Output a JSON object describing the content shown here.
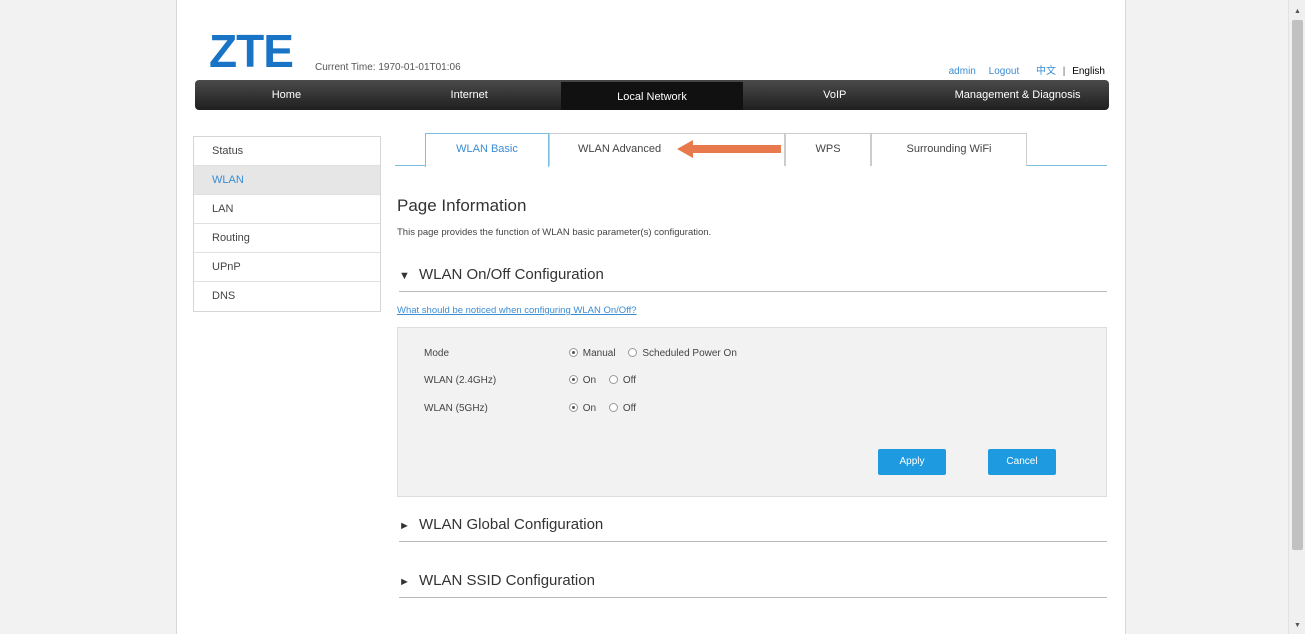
{
  "header": {
    "logo": "ZTE",
    "current_time": "Current Time: 1970-01-01T01:06",
    "user": "admin",
    "logout": "Logout",
    "lang_cn": "中文",
    "lang_sep": "|",
    "lang_en": "English"
  },
  "nav": {
    "items": [
      "Home",
      "Internet",
      "Local Network",
      "VoIP",
      "Management & Diagnosis"
    ],
    "active": "Local Network"
  },
  "sidebar": {
    "items": [
      "Status",
      "WLAN",
      "LAN",
      "Routing",
      "UPnP",
      "DNS"
    ],
    "active": "WLAN"
  },
  "tabs": {
    "items": [
      "WLAN Basic",
      "WLAN Advanced",
      "WPS",
      "Surrounding WiFi"
    ],
    "active": "WLAN Basic"
  },
  "page": {
    "title": "Page Information",
    "description": "This page provides the function of WLAN basic parameter(s) configuration."
  },
  "sections": {
    "onoff": "WLAN On/Off Configuration",
    "global": "WLAN Global Configuration",
    "ssid": "WLAN SSID Configuration"
  },
  "help_link": "What should be noticed when configuring WLAN On/Off?",
  "form": {
    "mode_label": "Mode",
    "mode_opt1": "Manual",
    "mode_opt2": "Scheduled Power On",
    "wlan24_label": "WLAN (2.4GHz)",
    "wlan5_label": "WLAN (5GHz)",
    "on": "On",
    "off": "Off",
    "apply": "Apply",
    "cancel": "Cancel"
  },
  "colors": {
    "brand": "#1a74c5",
    "accent": "#1e9be0",
    "arrow": "#e8794c"
  }
}
